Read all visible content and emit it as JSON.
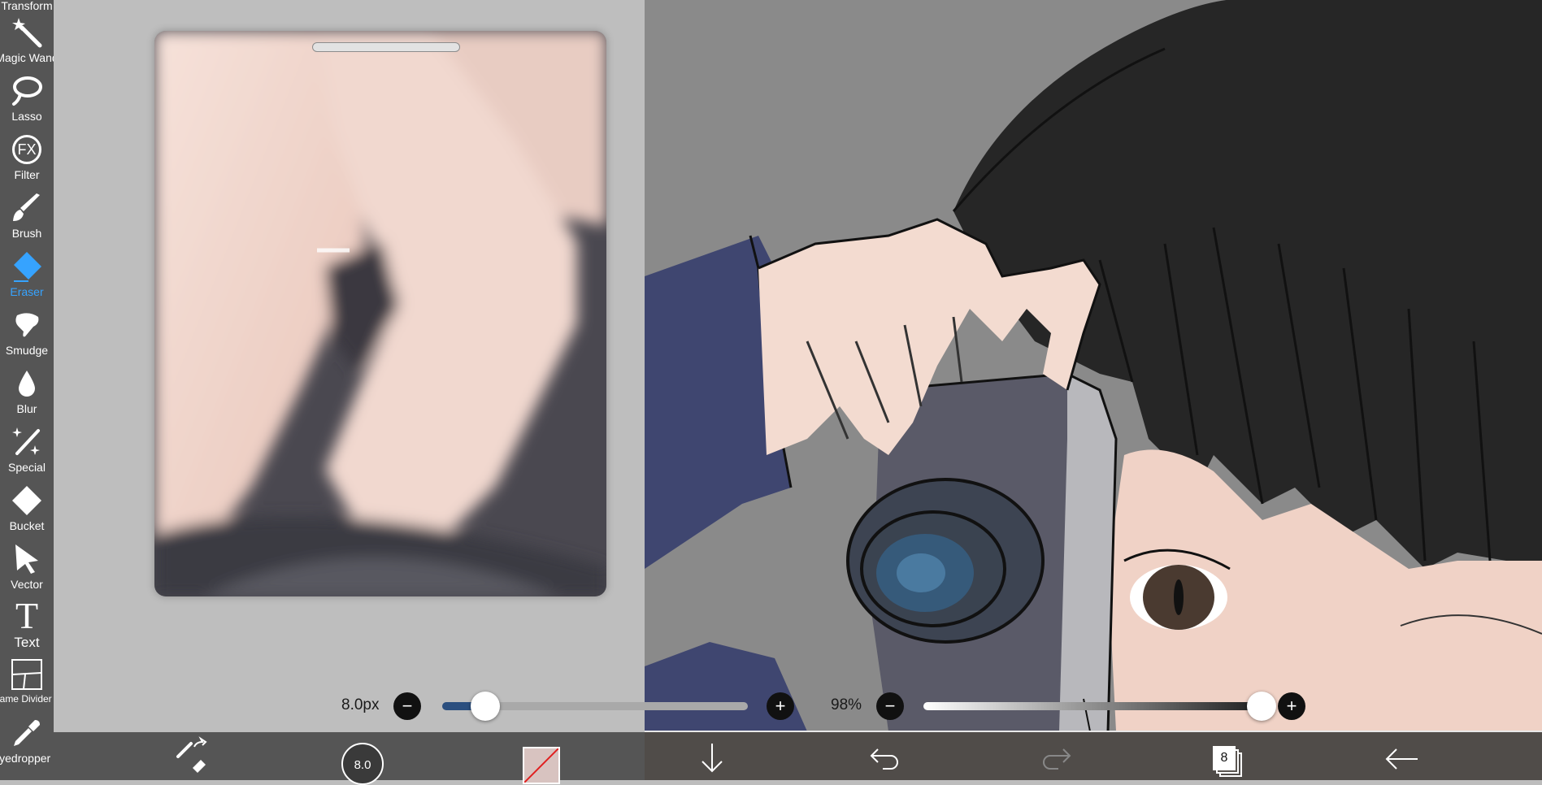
{
  "toolbar": {
    "tools": [
      {
        "label": "Transform",
        "icon": "transform-icon"
      },
      {
        "label": "Magic Wand",
        "icon": "magic-wand-icon"
      },
      {
        "label": "Lasso",
        "icon": "lasso-icon"
      },
      {
        "label": "Filter",
        "icon": "fx-filter-icon",
        "icon_text": "FX"
      },
      {
        "label": "Brush",
        "icon": "brush-icon"
      },
      {
        "label": "Eraser",
        "icon": "eraser-icon",
        "active": true
      },
      {
        "label": "Smudge",
        "icon": "smudge-icon"
      },
      {
        "label": "Blur",
        "icon": "blur-drop-icon"
      },
      {
        "label": "Special",
        "icon": "special-sparkle-icon"
      },
      {
        "label": "Bucket",
        "icon": "bucket-icon"
      },
      {
        "label": "Vector",
        "icon": "vector-arrow-icon"
      },
      {
        "label": "Text",
        "icon": "text-icon",
        "icon_text": "T"
      },
      {
        "label": "Frame Divider",
        "icon": "frame-divider-icon"
      },
      {
        "label": "Eyedropper",
        "icon": "eyedropper-icon"
      }
    ],
    "active_color": "#36a3ff"
  },
  "brush_size": {
    "value_label": "8.0px",
    "minus": "−",
    "plus": "+",
    "fraction": 0.14,
    "fill_color": "#2b4f7f"
  },
  "opacity": {
    "value_label": "98%",
    "minus": "−",
    "plus": "+",
    "fraction": 0.98
  },
  "bottom_bar": {
    "brush_size_badge": "8.0",
    "layer_count": "8",
    "current_color": "#d8c3c0"
  },
  "colors": {
    "toolbar_bg": "#555555",
    "reference_bg": "#bebebe",
    "canvas_bg": "#8a8a8a",
    "hair": "#262626",
    "skin": "#f0d2c6",
    "sleeve": "#3f4670"
  }
}
